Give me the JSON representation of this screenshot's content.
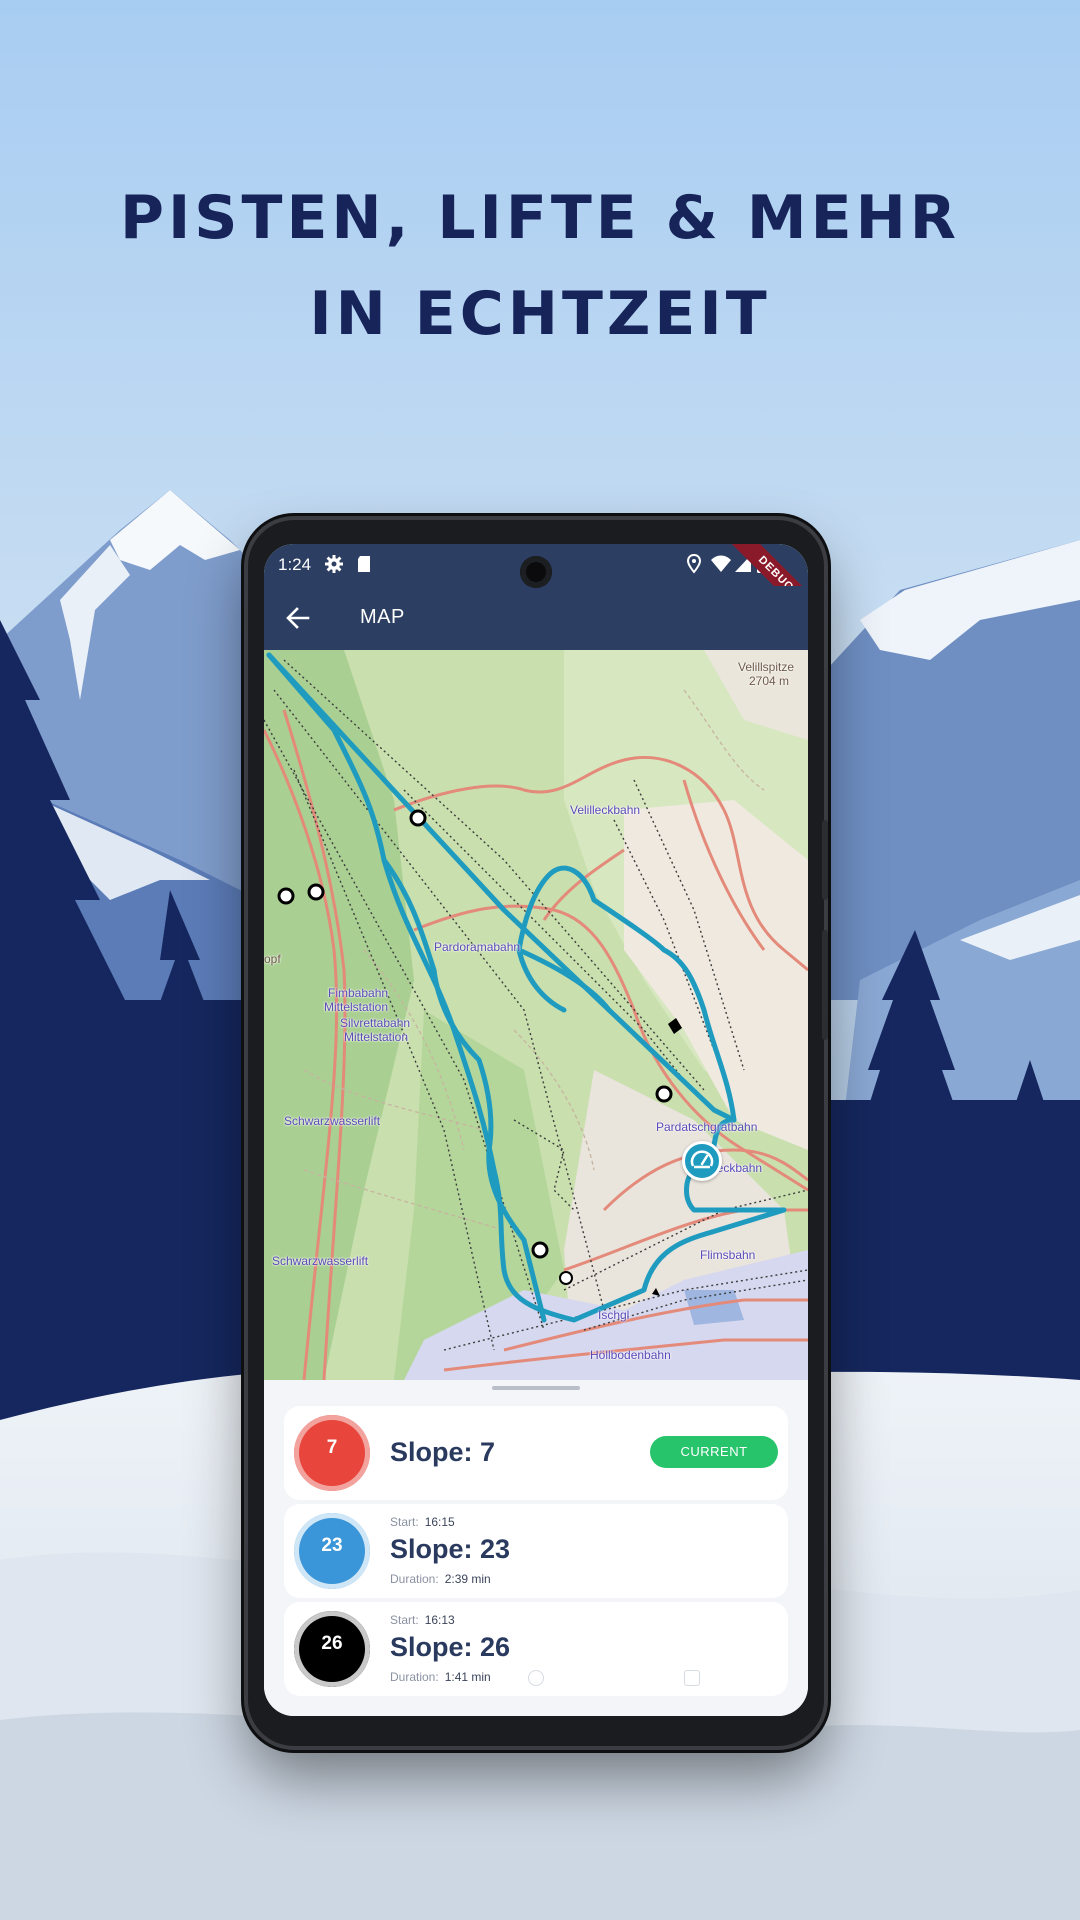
{
  "headline": {
    "line1": "PISTEN, LIFTE & MEHR",
    "line2": "IN ECHTZEIT"
  },
  "statusbar": {
    "time": "1:24",
    "icons": [
      "settings-icon",
      "sd-card-icon",
      "location-icon",
      "wifi-icon",
      "signal-icon",
      "battery-icon"
    ],
    "debug_banner": "DEBUG"
  },
  "appbar": {
    "back_icon": "arrow-left-icon",
    "title": "MAP"
  },
  "map": {
    "labels": {
      "velillspitze": "Velillspitze",
      "velillspitze_alt": "2704 m",
      "velilleckbahn": "Velilleckbahn",
      "pardoramabahn": "Pardoramabahn",
      "fimbabahn": "Fimbabahn",
      "fimba_mittelstation": "Mittelstation",
      "silvrettabahn": "Silvrettabahn",
      "silvretta_mittelstation": "Mittelstation",
      "schwarzwasserlift_1": "Schwarzwasserlift",
      "schwarzwasserlift_2": "Schwarzwasserlift",
      "pardatschgratbahn": "Pardatschgratbahn",
      "velilleckbahn_2": "Velilleckbahn",
      "opf": "opf",
      "flimsbahn": "Flimsbahn",
      "ischgl": "Ischgl",
      "hollbodenbahn": "Höllbodenbahn"
    },
    "track_color": "#1e9bbf",
    "marker_icon": "speedometer-icon"
  },
  "slopes": [
    {
      "number": "7",
      "label": "Slope: 7",
      "color": "#e8453c",
      "ring": "#f3a39e",
      "status": "CURRENT"
    },
    {
      "number": "23",
      "label": "Slope: 23",
      "color": "#3a96d8",
      "ring": "#cfe6f7",
      "start_label": "Start:",
      "start": "16:15",
      "duration_label": "Duration:",
      "duration": "2:39 min"
    },
    {
      "number": "26",
      "label": "Slope: 26",
      "color": "#000000",
      "ring": "#c9c9c9",
      "start_label": "Start:",
      "start": "16:13",
      "duration_label": "Duration:",
      "duration": "1:41 min"
    }
  ]
}
